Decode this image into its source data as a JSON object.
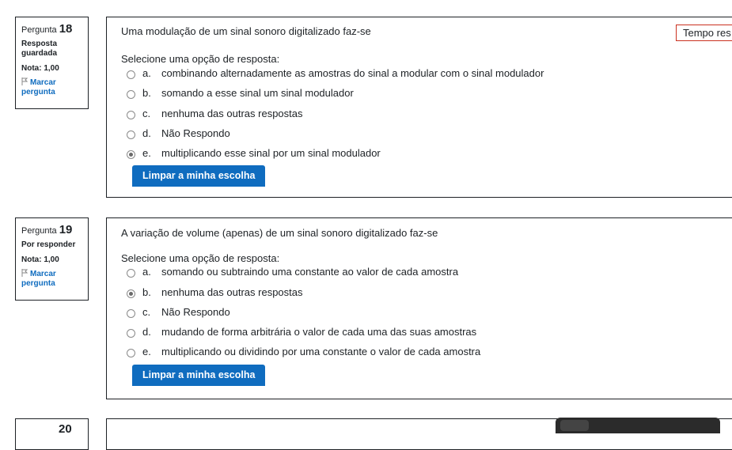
{
  "timer_label": "Tempo res",
  "questions": [
    {
      "label": "Pergunta",
      "number": "18",
      "state": "Resposta guardada",
      "grade": "Nota: 1,00",
      "flag": "Marcar pergunta",
      "text": "Uma modulação de um sinal sonoro digitalizado faz-se",
      "prompt": "Selecione uma opção de resposta:",
      "options": [
        {
          "letter": "a.",
          "text": "combinando alternadamente as amostras do sinal a modular com o sinal modulador",
          "checked": false
        },
        {
          "letter": "b.",
          "text": "somando a esse sinal um sinal modulador",
          "checked": false
        },
        {
          "letter": "c.",
          "text": "nenhuma das outras respostas",
          "checked": false
        },
        {
          "letter": "d.",
          "text": "Não Respondo",
          "checked": false
        },
        {
          "letter": "e.",
          "text": "multiplicando esse sinal por um sinal modulador",
          "checked": true
        }
      ],
      "clear_label": "Limpar a minha escolha"
    },
    {
      "label": "Pergunta",
      "number": "19",
      "state": "Por responder",
      "grade": "Nota: 1,00",
      "flag": "Marcar pergunta",
      "text": "A variação de volume (apenas) de um sinal sonoro digitalizado faz-se",
      "prompt": "Selecione uma opção de resposta:",
      "options": [
        {
          "letter": "a.",
          "text": "somando ou subtraindo uma constante ao valor de cada amostra",
          "checked": false
        },
        {
          "letter": "b.",
          "text": "nenhuma das outras respostas",
          "checked": true
        },
        {
          "letter": "c.",
          "text": "Não Respondo",
          "checked": false
        },
        {
          "letter": "d.",
          "text": "mudando de forma arbitrária o valor de cada uma das suas amostras",
          "checked": false
        },
        {
          "letter": "e.",
          "text": "multiplicando ou dividindo por uma constante o valor de cada amostra",
          "checked": false
        }
      ],
      "clear_label": "Limpar a minha escolha"
    },
    {
      "number": "20"
    }
  ]
}
